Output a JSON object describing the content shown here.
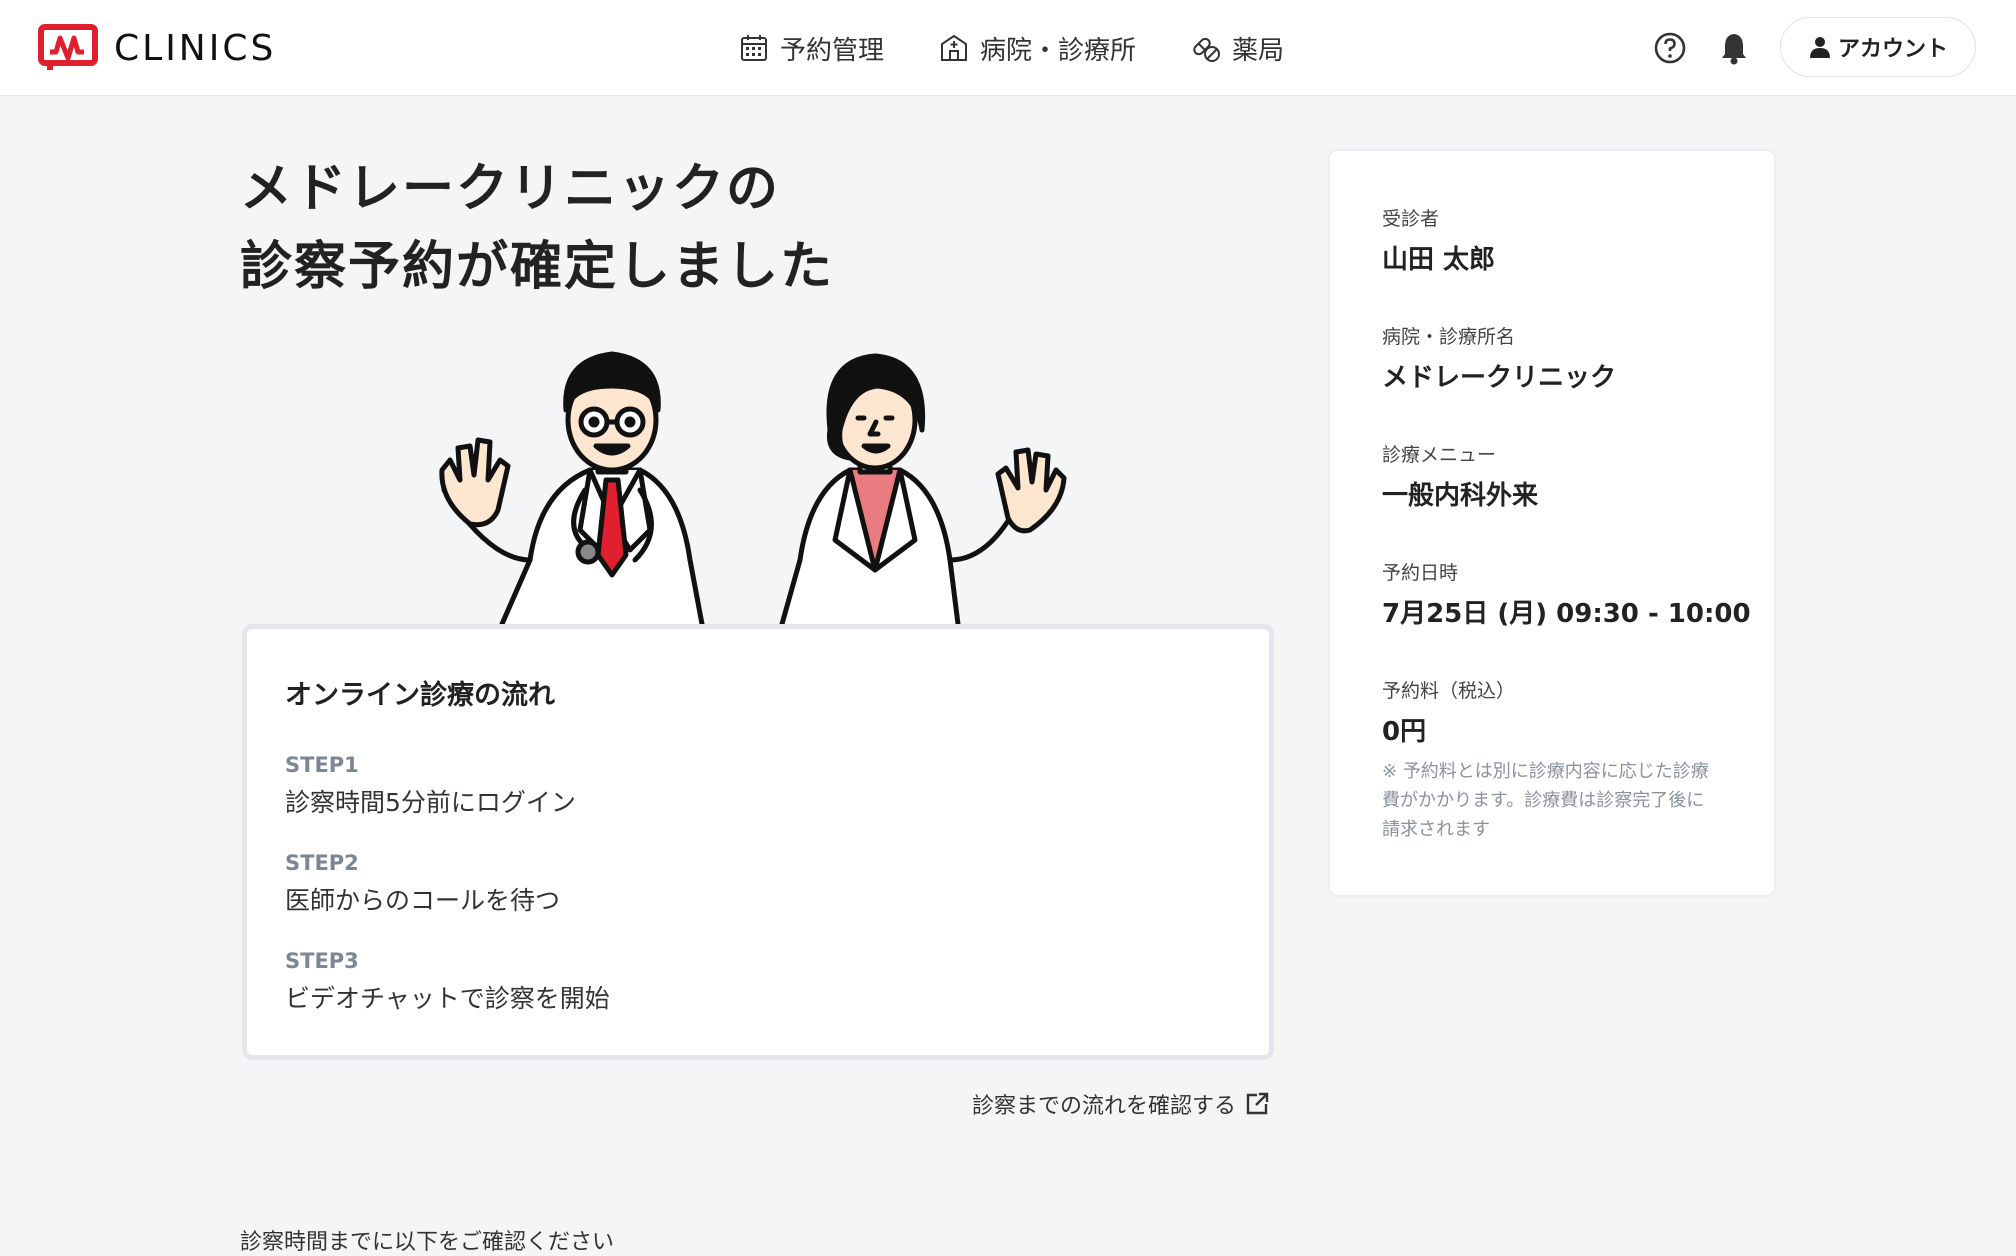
{
  "header": {
    "logo_text": "CLINICS",
    "brand_color": "#e0202e",
    "nav": [
      {
        "label": "予約管理",
        "icon": "calendar-icon"
      },
      {
        "label": "病院・診療所",
        "icon": "hospital-icon"
      },
      {
        "label": "薬局",
        "icon": "pill-icon"
      }
    ],
    "help_icon": "help-icon",
    "bell_icon": "bell-icon",
    "account_label": "アカウント"
  },
  "main": {
    "title_line1": "メドレークリニックの",
    "title_line2": "診察予約が確定しました",
    "flow": {
      "title": "オンライン診療の流れ",
      "steps": [
        {
          "label": "STEP1",
          "text": "診察時間5分前にログイン"
        },
        {
          "label": "STEP2",
          "text": "医師からのコールを待つ"
        },
        {
          "label": "STEP3",
          "text": "ビデオチャットで診察を開始"
        }
      ]
    },
    "flow_link": "診察までの流れを確認する",
    "confirm_text": "診察時間までに以下をご確認ください"
  },
  "sidebar": {
    "patient_label": "受診者",
    "patient_value": "山田 太郎",
    "clinic_label": "病院・診療所名",
    "clinic_value": "メドレークリニック",
    "menu_label": "診療メニュー",
    "menu_value": "一般内科外来",
    "datetime_label": "予約日時",
    "datetime_value": "7月25日 (月) 09:30 - 10:00",
    "fee_label": "予約料（税込）",
    "fee_value": "0円",
    "fee_note": "※ 予約料とは別に診療内容に応じた診療費がかかります。診療費は診察完了後に請求されます"
  }
}
